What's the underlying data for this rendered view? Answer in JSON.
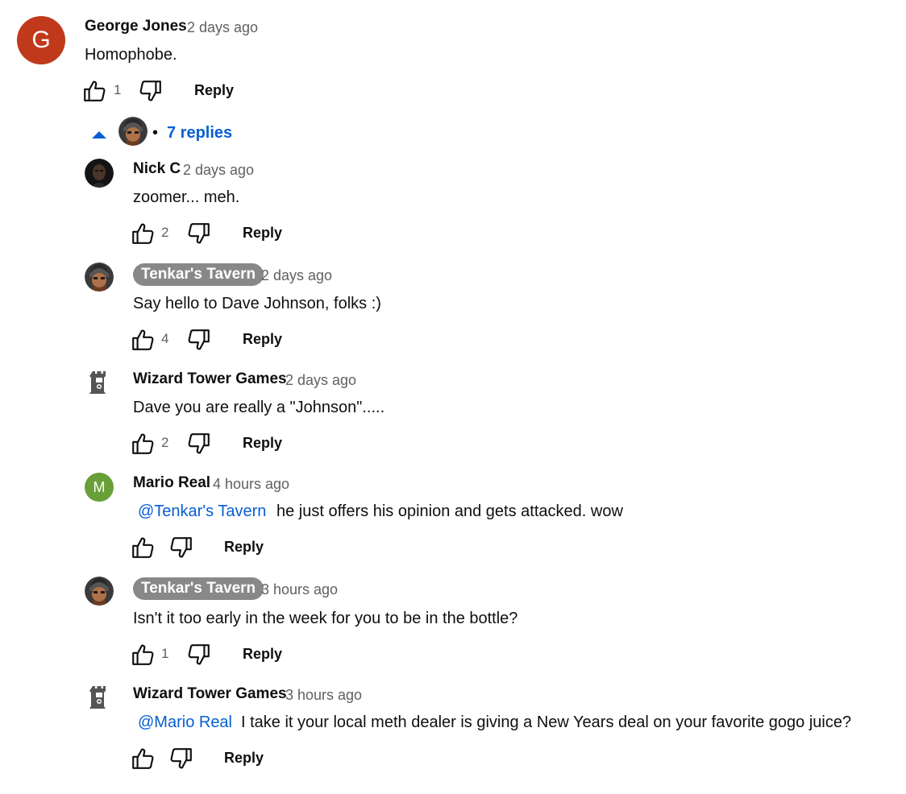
{
  "colors": {
    "accent_blue": "#065fd4",
    "avatar_george": "#c0391b",
    "avatar_mario": "#689f38",
    "channel_badge": "#888888",
    "meta_gray": "#606060"
  },
  "icons": {
    "like": "thumbs-up-outline-icon",
    "dislike": "thumbs-down-outline-icon",
    "collapse": "caret-up-icon",
    "wizard_avatar": "tower-logo-icon"
  },
  "top_comment": {
    "avatar_letter": "G",
    "author": "George Jones",
    "time": "2 days ago",
    "text": "Homophobe.",
    "likes": "1",
    "reply_label": "Reply"
  },
  "replies_toggle": {
    "label": "7 replies",
    "separator": "•"
  },
  "replies": [
    {
      "author": "Nick C",
      "time": "2 days ago",
      "mention": "",
      "text": "zoomer... meh.",
      "likes": "2",
      "reply_label": "Reply"
    },
    {
      "author": "Tenkar's Tavern",
      "time": "2 days ago",
      "mention": "",
      "text": "Say hello to Dave Johnson, folks :)",
      "likes": "4",
      "reply_label": "Reply"
    },
    {
      "author": "Wizard Tower Games",
      "time": "2 days ago",
      "mention": "",
      "text": "Dave you are really a \"Johnson\".....",
      "likes": "2",
      "reply_label": "Reply"
    },
    {
      "avatar_letter": "M",
      "author": "Mario Real",
      "time": "4 hours ago",
      "mention": "@Tenkar's Tavern",
      "text": "he just offers his opinion and gets attacked. wow",
      "likes": "",
      "reply_label": "Reply"
    },
    {
      "author": "Tenkar's Tavern",
      "time": "3 hours ago",
      "mention": "",
      "text": "Isn't it too early in the week for you to be in the bottle?",
      "likes": "1",
      "reply_label": "Reply"
    },
    {
      "author": "Wizard Tower Games",
      "time": "3 hours ago",
      "mention": "@Mario Real",
      "text": "I take it your local meth dealer is giving a New Years deal on your favorite gogo juice?",
      "likes": "",
      "reply_label": "Reply"
    }
  ]
}
